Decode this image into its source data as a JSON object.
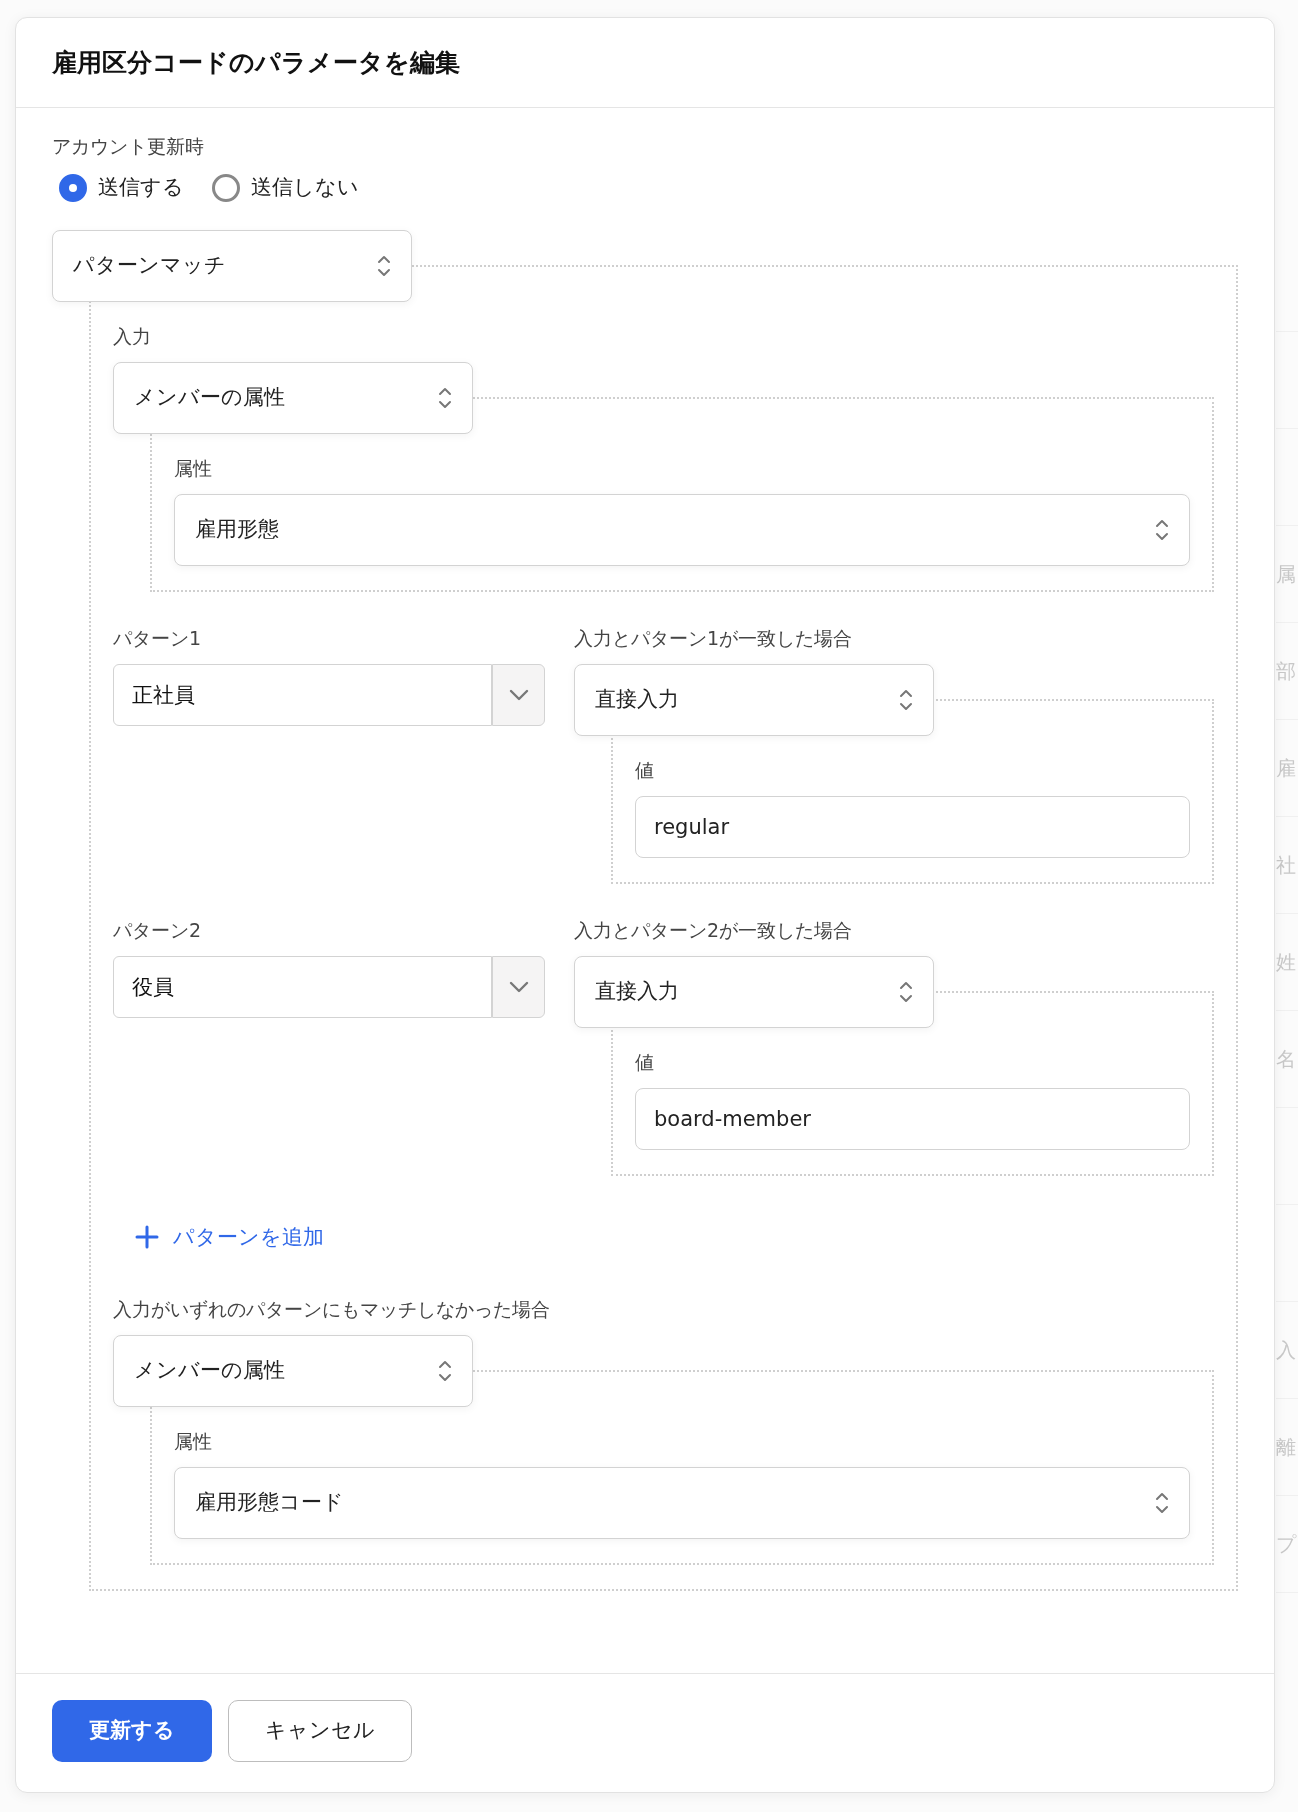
{
  "dialog_title": "雇用区分コードのパラメータを編集",
  "send_on_update": {
    "label": "アカウント更新時",
    "options": [
      {
        "label": "送信する",
        "selected": true
      },
      {
        "label": "送信しない",
        "selected": false
      }
    ]
  },
  "rule": {
    "kind": "pattern_match",
    "value": "パターンマッチ",
    "input": {
      "label": "入力",
      "kind": "attribute",
      "value": "メンバーの属性",
      "attribute": {
        "label": "属性",
        "value": "雇用形態"
      }
    },
    "patterns": [
      {
        "label": "パターン1",
        "value": "正社員",
        "result_label": "入力とパターン1が一致した場合",
        "result": {
          "kind": "direct",
          "value": "直接入力",
          "field_label": "値",
          "field_value": "regular"
        }
      },
      {
        "label": "パターン2",
        "value": "役員",
        "result_label": "入力とパターン2が一致した場合",
        "result": {
          "kind": "direct",
          "value": "直接入力",
          "field_label": "値",
          "field_value": "board-member"
        }
      }
    ],
    "add_pattern": "パターンを追加",
    "fallback": {
      "label": "入力がいずれのパターンにもマッチしなかった場合",
      "kind": "attribute",
      "value": "メンバーの属性",
      "attribute": {
        "label": "属性",
        "value": "雇用形態コード"
      }
    }
  },
  "buttons": [
    {
      "label": "更新する",
      "kind": "primary"
    },
    {
      "label": "キャンセル",
      "kind": "secondary"
    }
  ],
  "background_rows": [
    {},
    {},
    {
      "label": "属"
    },
    {
      "label": "部"
    },
    {
      "label": "雇"
    },
    {
      "label": "社"
    },
    {
      "label": "姓"
    },
    {
      "label": "名"
    },
    {},
    {},
    {
      "label": "入"
    },
    {
      "label": "離"
    },
    {
      "label": "プ"
    },
    {}
  ]
}
